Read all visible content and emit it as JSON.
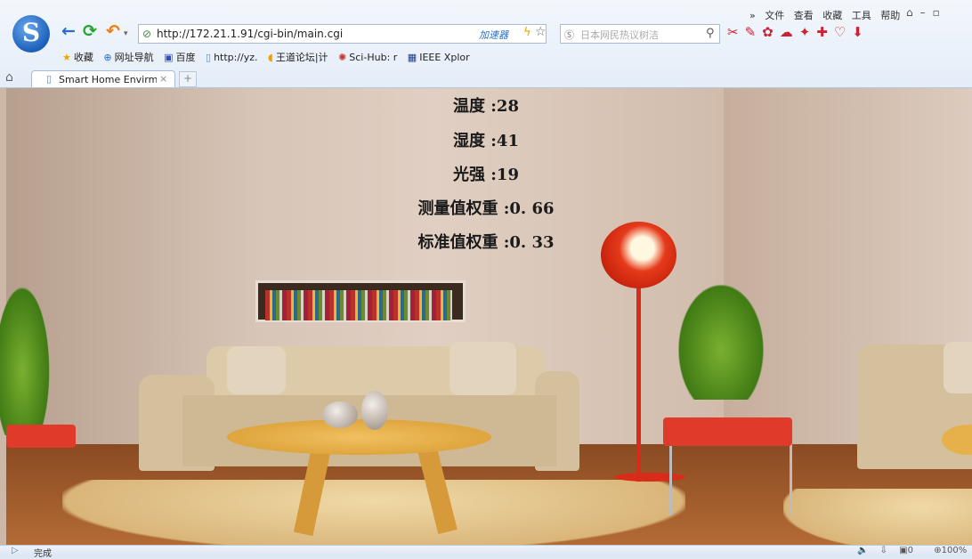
{
  "browser": {
    "url": "http://172.21.1.91/cgi-bin/main.cgi",
    "accelerator_label": "加速器",
    "search_placeholder": "日本网民热议树洁",
    "menu": [
      "文件",
      "查看",
      "收藏",
      "工具",
      "帮助"
    ],
    "menu_prefix": "»",
    "bookmarks": [
      "收藏",
      "网址导航",
      "百度",
      "http://yz.",
      "王道论坛|计",
      "Sci-Hub: r",
      "IEEE Xplor"
    ],
    "tab": {
      "title": "Smart Home Envirme",
      "close": "×"
    },
    "new_tab": "+"
  },
  "readings": [
    {
      "label": "温度",
      "value": "28"
    },
    {
      "label": "湿度",
      "value": "41"
    },
    {
      "label": "光强",
      "value": "19"
    },
    {
      "label": "测量值权重",
      "value": "0. 66"
    },
    {
      "label": "标准值权重",
      "value": "0. 33"
    }
  ],
  "status": {
    "text": "完成",
    "mute_icon": "🔈",
    "zoom": "100%",
    "count": "0"
  },
  "icons": [
    "back-icon",
    "refresh-icon",
    "undo-icon",
    "shield-icon",
    "bolt-icon",
    "star-icon",
    "search-icon",
    "home-icon",
    "page-icon",
    "close-icon"
  ]
}
